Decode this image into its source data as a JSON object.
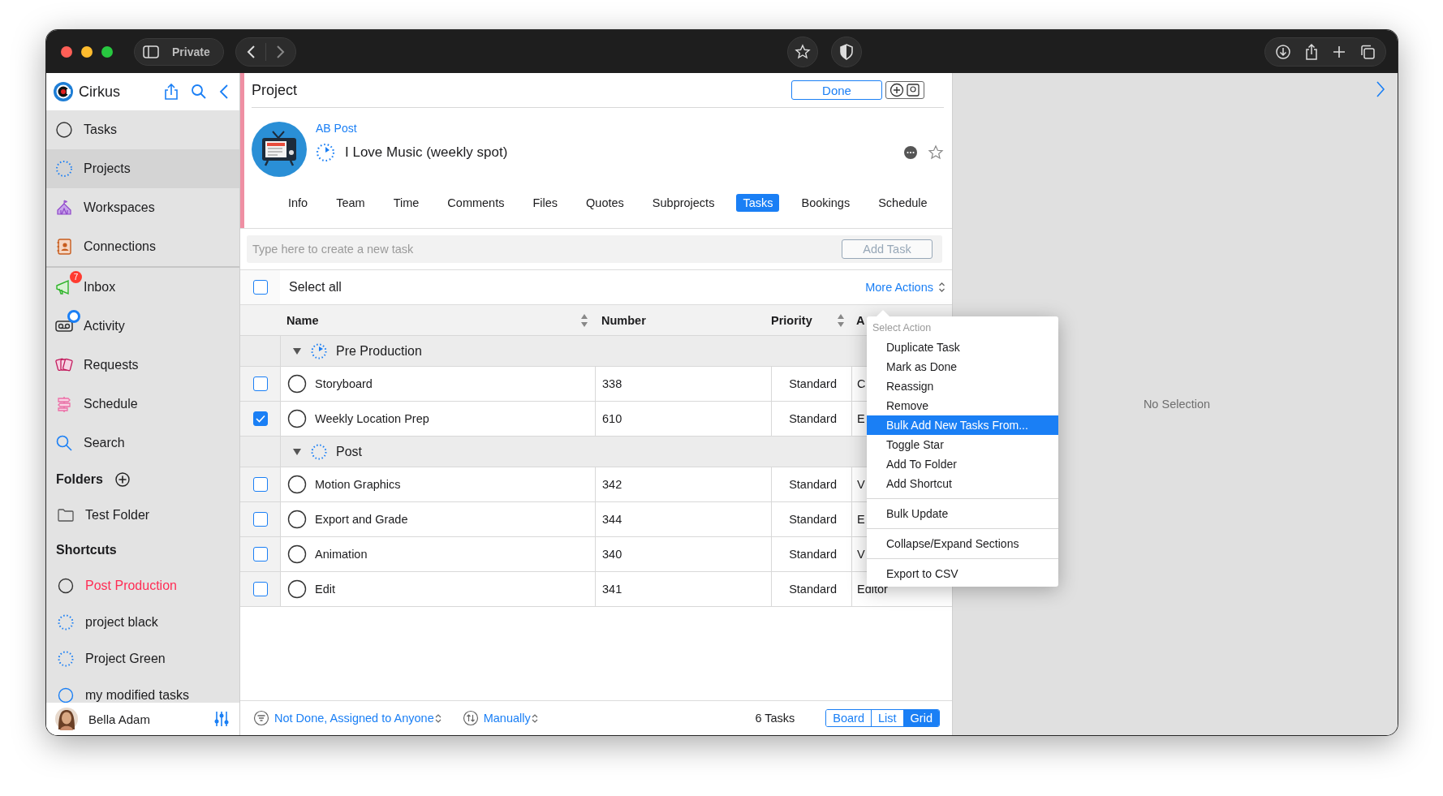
{
  "browser": {
    "private_label": "Private"
  },
  "sidebar": {
    "app_name": "Cirkus",
    "nav_items": [
      {
        "label": "Tasks",
        "selected": false,
        "dot": false
      },
      {
        "label": "Projects",
        "selected": true,
        "dot": false
      },
      {
        "label": "Workspaces",
        "selected": false,
        "dot": false
      },
      {
        "label": "Connections",
        "selected": false,
        "dot": false
      },
      {
        "label": "Inbox",
        "selected": false,
        "badge": "7",
        "dot": false
      },
      {
        "label": "Activity",
        "selected": false,
        "dot": true
      },
      {
        "label": "Requests",
        "selected": false,
        "dot": false
      },
      {
        "label": "Schedule",
        "selected": false,
        "dot": false
      },
      {
        "label": "Search",
        "selected": false,
        "dot": false
      }
    ],
    "folders_heading": "Folders",
    "folders": [
      {
        "label": "Test Folder"
      }
    ],
    "shortcuts_heading": "Shortcuts",
    "shortcuts": [
      {
        "label": "Post Production",
        "kind": "task",
        "color": "#ff2d55"
      },
      {
        "label": "project black",
        "kind": "project",
        "color": "#1c1c1e"
      },
      {
        "label": "Project Green",
        "kind": "project",
        "color": "#1c1c1e"
      },
      {
        "label": "my modified tasks",
        "kind": "task",
        "color": "#1c1c1e"
      }
    ],
    "user": {
      "name": "Bella Adam"
    }
  },
  "project": {
    "heading": "Project",
    "done_button": "Done",
    "client": "AB Post",
    "title": "I Love Music (weekly spot)",
    "tabs": [
      {
        "label": "Info",
        "selected": false
      },
      {
        "label": "Team",
        "selected": false
      },
      {
        "label": "Time",
        "selected": false
      },
      {
        "label": "Comments",
        "selected": false
      },
      {
        "label": "Files",
        "selected": false
      },
      {
        "label": "Quotes",
        "selected": false
      },
      {
        "label": "Subprojects",
        "selected": false
      },
      {
        "label": "Tasks",
        "selected": true
      },
      {
        "label": "Bookings",
        "selected": false
      },
      {
        "label": "Schedule",
        "selected": false
      }
    ],
    "new_task": {
      "placeholder": "Type here to create a new task",
      "button": "Add Task"
    },
    "select_all": {
      "label": "Select all",
      "checked": false
    },
    "more_actions": "More Actions",
    "table": {
      "columns": [
        {
          "label": "Name",
          "sortable": true
        },
        {
          "label": "Number",
          "sortable": false
        },
        {
          "label": "Priority",
          "sortable": true
        },
        {
          "label": "A",
          "sortable": false
        }
      ],
      "sections": [
        {
          "name": "Pre Production",
          "expanded": true,
          "kind": "started",
          "rows": [
            {
              "checked": false,
              "name": "Storyboard",
              "number": "338",
              "priority": "Standard",
              "column_4": "C"
            },
            {
              "checked": true,
              "name": "Weekly Location Prep",
              "number": "610",
              "priority": "Standard",
              "column_4": "E"
            }
          ]
        },
        {
          "name": "Post",
          "expanded": true,
          "kind": "project",
          "rows": [
            {
              "checked": false,
              "name": "Motion Graphics",
              "number": "342",
              "priority": "Standard",
              "column_4": "V"
            },
            {
              "checked": false,
              "name": "Export and Grade",
              "number": "344",
              "priority": "Standard",
              "column_4": "E"
            },
            {
              "checked": false,
              "name": "Animation",
              "number": "340",
              "priority": "Standard",
              "column_4": "V"
            },
            {
              "checked": false,
              "name": "Edit",
              "number": "341",
              "priority": "Standard",
              "column_4": "Editor"
            }
          ]
        }
      ]
    },
    "menu": {
      "title": "Select Action",
      "groups": [
        [
          {
            "label": "Duplicate Task",
            "selected": false
          },
          {
            "label": "Mark as Done",
            "selected": false
          },
          {
            "label": "Reassign",
            "selected": false
          },
          {
            "label": "Remove",
            "selected": false
          },
          {
            "label": "Bulk Add New Tasks From...",
            "selected": true
          },
          {
            "label": "Toggle Star",
            "selected": false
          },
          {
            "label": "Add To Folder",
            "selected": false
          },
          {
            "label": "Add Shortcut",
            "selected": false
          }
        ],
        [
          {
            "label": "Bulk Update",
            "selected": false
          }
        ],
        [
          {
            "label": "Collapse/Expand Sections",
            "selected": false
          }
        ],
        [
          {
            "label": "Export to CSV",
            "selected": false
          }
        ]
      ]
    },
    "footer": {
      "filter": "Not Done, Assigned to Anyone",
      "sort": "Manually",
      "count": "6 Tasks",
      "views": [
        {
          "label": "Board",
          "selected": false
        },
        {
          "label": "List",
          "selected": false
        },
        {
          "label": "Grid",
          "selected": true
        }
      ]
    }
  },
  "detail": {
    "empty_text": "No Selection"
  }
}
